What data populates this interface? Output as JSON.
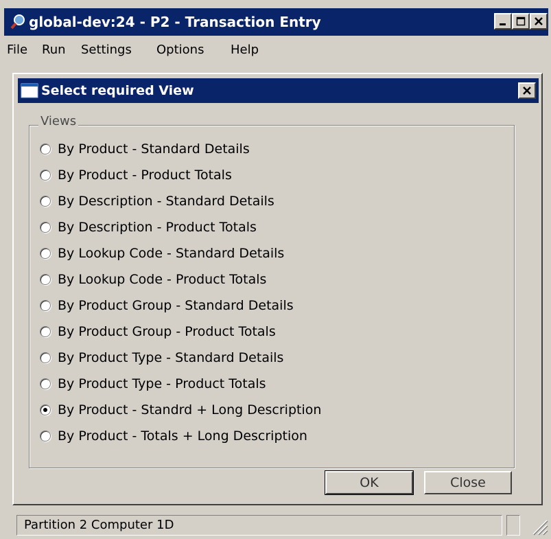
{
  "window": {
    "title": "global-dev:24 - P2 - Transaction Entry",
    "icon": "magnifier-app-icon",
    "controls": [
      "minimize-icon",
      "maximize-icon",
      "close-icon"
    ]
  },
  "menu": {
    "items": [
      "File",
      "Run",
      "Settings",
      "Options",
      "Help"
    ]
  },
  "dialog": {
    "title": "Select required View",
    "group_label": "Views",
    "options": [
      {
        "label": "By Product - Standard Details",
        "selected": false
      },
      {
        "label": "By Product - Product Totals",
        "selected": false
      },
      {
        "label": "By Description - Standard Details",
        "selected": false
      },
      {
        "label": "By Description - Product Totals",
        "selected": false
      },
      {
        "label": "By Lookup Code - Standard Details",
        "selected": false
      },
      {
        "label": "By Lookup Code - Product Totals",
        "selected": false
      },
      {
        "label": "By Product Group - Standard Details",
        "selected": false
      },
      {
        "label": "By Product Group - Product Totals",
        "selected": false
      },
      {
        "label": "By Product Type - Standard Details",
        "selected": false
      },
      {
        "label": "By Product Type - Product Totals",
        "selected": false
      },
      {
        "label": "By Product - Standrd + Long Description",
        "selected": true
      },
      {
        "label": "By Product - Totals + Long Description",
        "selected": false
      }
    ],
    "ok_label": "OK",
    "close_label": "Close"
  },
  "status": {
    "text": "Partition 2 Computer 1D"
  },
  "colors": {
    "titlebar": "#0a246a",
    "face": "#d4d0c8"
  }
}
